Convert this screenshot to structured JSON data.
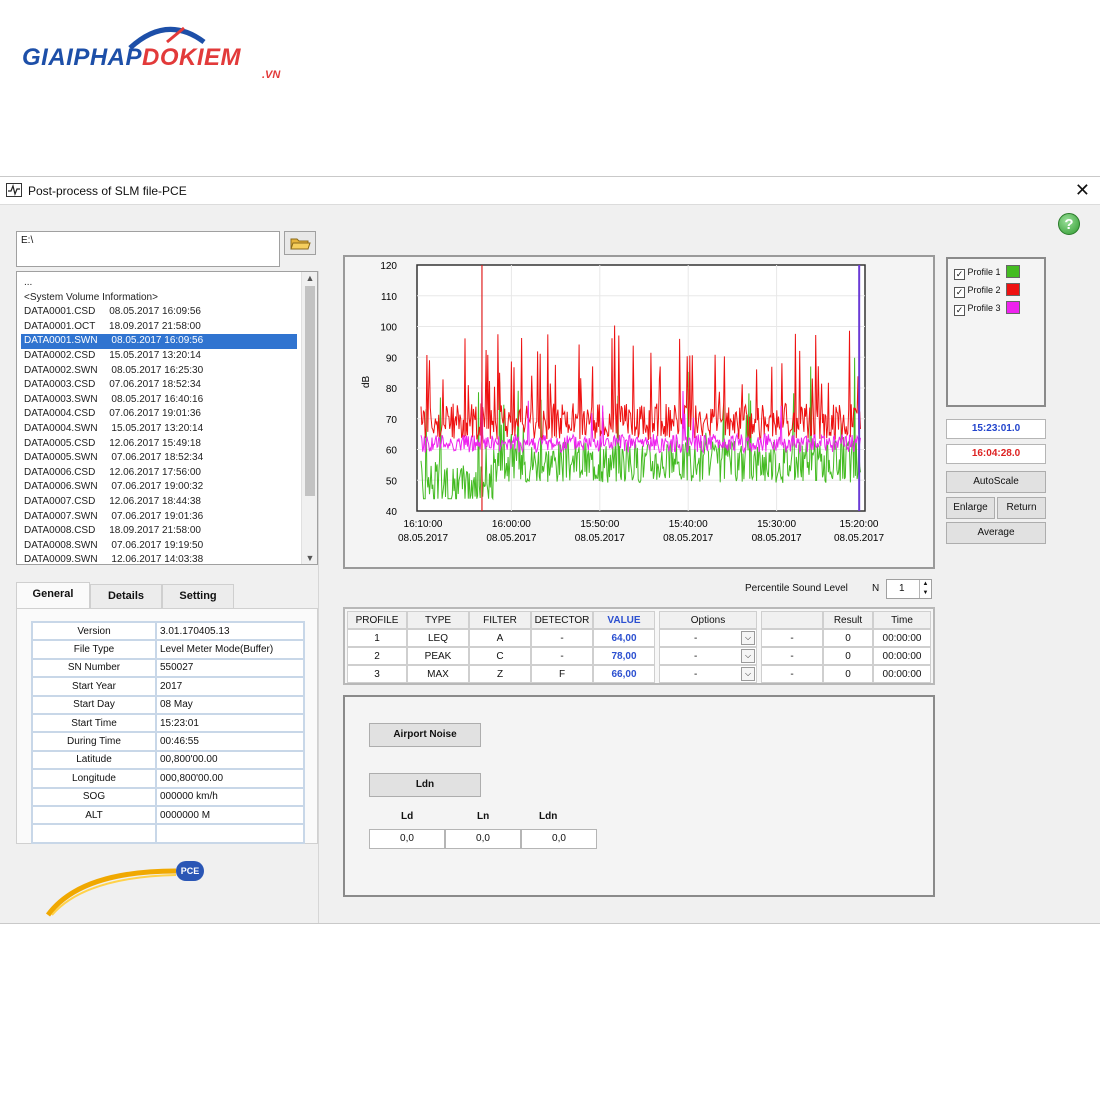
{
  "logo": {
    "brand_blue": "GIAIPHAP",
    "brand_red": "DOKIEM",
    "suffix": ".VN"
  },
  "window": {
    "title": "Post-process of SLM file-PCE",
    "help": "?",
    "close": "✕"
  },
  "path": "E:\\",
  "files": [
    "...",
    "<System Volume Information>",
    "DATA0001.CSD     08.05.2017 16:09:56",
    "DATA0001.OCT     18.09.2017 21:58:00",
    "DATA0001.SWN     08.05.2017 16:09:56",
    "DATA0002.CSD     15.05.2017 13:20:14",
    "DATA0002.SWN     08.05.2017 16:25:30",
    "DATA0003.CSD     07.06.2017 18:52:34",
    "DATA0003.SWN     08.05.2017 16:40:16",
    "DATA0004.CSD     07.06.2017 19:01:36",
    "DATA0004.SWN     15.05.2017 13:20:14",
    "DATA0005.CSD     12.06.2017 15:49:18",
    "DATA0005.SWN     07.06.2017 18:52:34",
    "DATA0006.CSD     12.06.2017 17:56:00",
    "DATA0006.SWN     07.06.2017 19:00:32",
    "DATA0007.CSD     12.06.2017 18:44:38",
    "DATA0007.SWN     07.06.2017 19:01:36",
    "DATA0008.CSD     18.09.2017 21:58:00",
    "DATA0008.SWN     07.06.2017 19:19:50",
    "DATA0009.SWN     12.06.2017 14:03:38"
  ],
  "tabs": [
    "General",
    "Details",
    "Setting"
  ],
  "general": [
    [
      "Version",
      "3.01.170405.13"
    ],
    [
      "File Type",
      "Level Meter Mode(Buffer)"
    ],
    [
      "SN Number",
      "550027"
    ],
    [
      "Start Year",
      "2017"
    ],
    [
      "Start Day",
      "08 May"
    ],
    [
      "Start Time",
      "15:23:01"
    ],
    [
      "During Time",
      "00:46:55"
    ],
    [
      "Latitude",
      "00,800'00.00"
    ],
    [
      "Longitude",
      "000,800'00.00"
    ],
    [
      "SOG",
      "000000 km/h"
    ],
    [
      "ALT",
      "0000000 M"
    ],
    [
      "",
      ""
    ]
  ],
  "pce_badge": "PCE",
  "chart_data": {
    "type": "line",
    "ylabel": "dB",
    "ylim": [
      40,
      120
    ],
    "yticks": [
      120,
      110,
      100,
      90,
      80,
      70,
      60,
      50,
      40
    ],
    "xticks": [
      [
        "16:10:00",
        "08.05.2017"
      ],
      [
        "16:00:00",
        "08.05.2017"
      ],
      [
        "15:50:00",
        "08.05.2017"
      ],
      [
        "15:40:00",
        "08.05.2017"
      ],
      [
        "15:30:00",
        "08.05.2017"
      ],
      [
        "15:20:00",
        "08.05.2017"
      ]
    ],
    "grid": true,
    "cursor_color": "#e02020",
    "series": [
      {
        "name": "Profile 1",
        "color": "#44bb22",
        "baseline": 52,
        "spread": 7,
        "spikes": 12
      },
      {
        "name": "Profile 2",
        "color": "#ee1111",
        "baseline": 69,
        "spread": 6,
        "spikes": 22
      },
      {
        "name": "Profile 3",
        "color": "#ee22ee",
        "baseline": 62,
        "spread": 3,
        "spikes": 6
      }
    ]
  },
  "legend": [
    {
      "label": "Profile 1",
      "color": "#44bb22",
      "checked": "✓"
    },
    {
      "label": "Profile 2",
      "color": "#ee1111",
      "checked": "✓"
    },
    {
      "label": "Profile 3",
      "color": "#ee22ee",
      "checked": "✓"
    }
  ],
  "time_start": {
    "text": "15:23:01.0",
    "color": "#2244cc"
  },
  "time_end": {
    "text": "16:04:28.0",
    "color": "#dd2222"
  },
  "buttons": {
    "autoscale": "AutoScale",
    "enlarge": "Enlarge",
    "return": "Return",
    "average": "Average"
  },
  "percentile": {
    "label": "Percentile Sound Level",
    "n_label": "N",
    "value": "1"
  },
  "profile_table": {
    "headers": [
      "PROFILE",
      "TYPE",
      "FILTER",
      "DETECTOR",
      "VALUE",
      "Options",
      "",
      "Result",
      "Time"
    ],
    "rows": [
      [
        "1",
        "LEQ",
        "A",
        "-",
        "64,00",
        "-",
        "-",
        "0",
        "00:00:00"
      ],
      [
        "2",
        "PEAK",
        "C",
        "-",
        "78,00",
        "-",
        "-",
        "0",
        "00:00:00"
      ],
      [
        "3",
        "MAX",
        "Z",
        "F",
        "66,00",
        "-",
        "-",
        "0",
        "00:00:00"
      ]
    ]
  },
  "airport": {
    "airport_btn": "Airport Noise",
    "ldn_btn": "Ldn",
    "labels": [
      "Ld",
      "Ln",
      "Ldn"
    ],
    "values": [
      "0,0",
      "0,0",
      "0,0"
    ]
  }
}
